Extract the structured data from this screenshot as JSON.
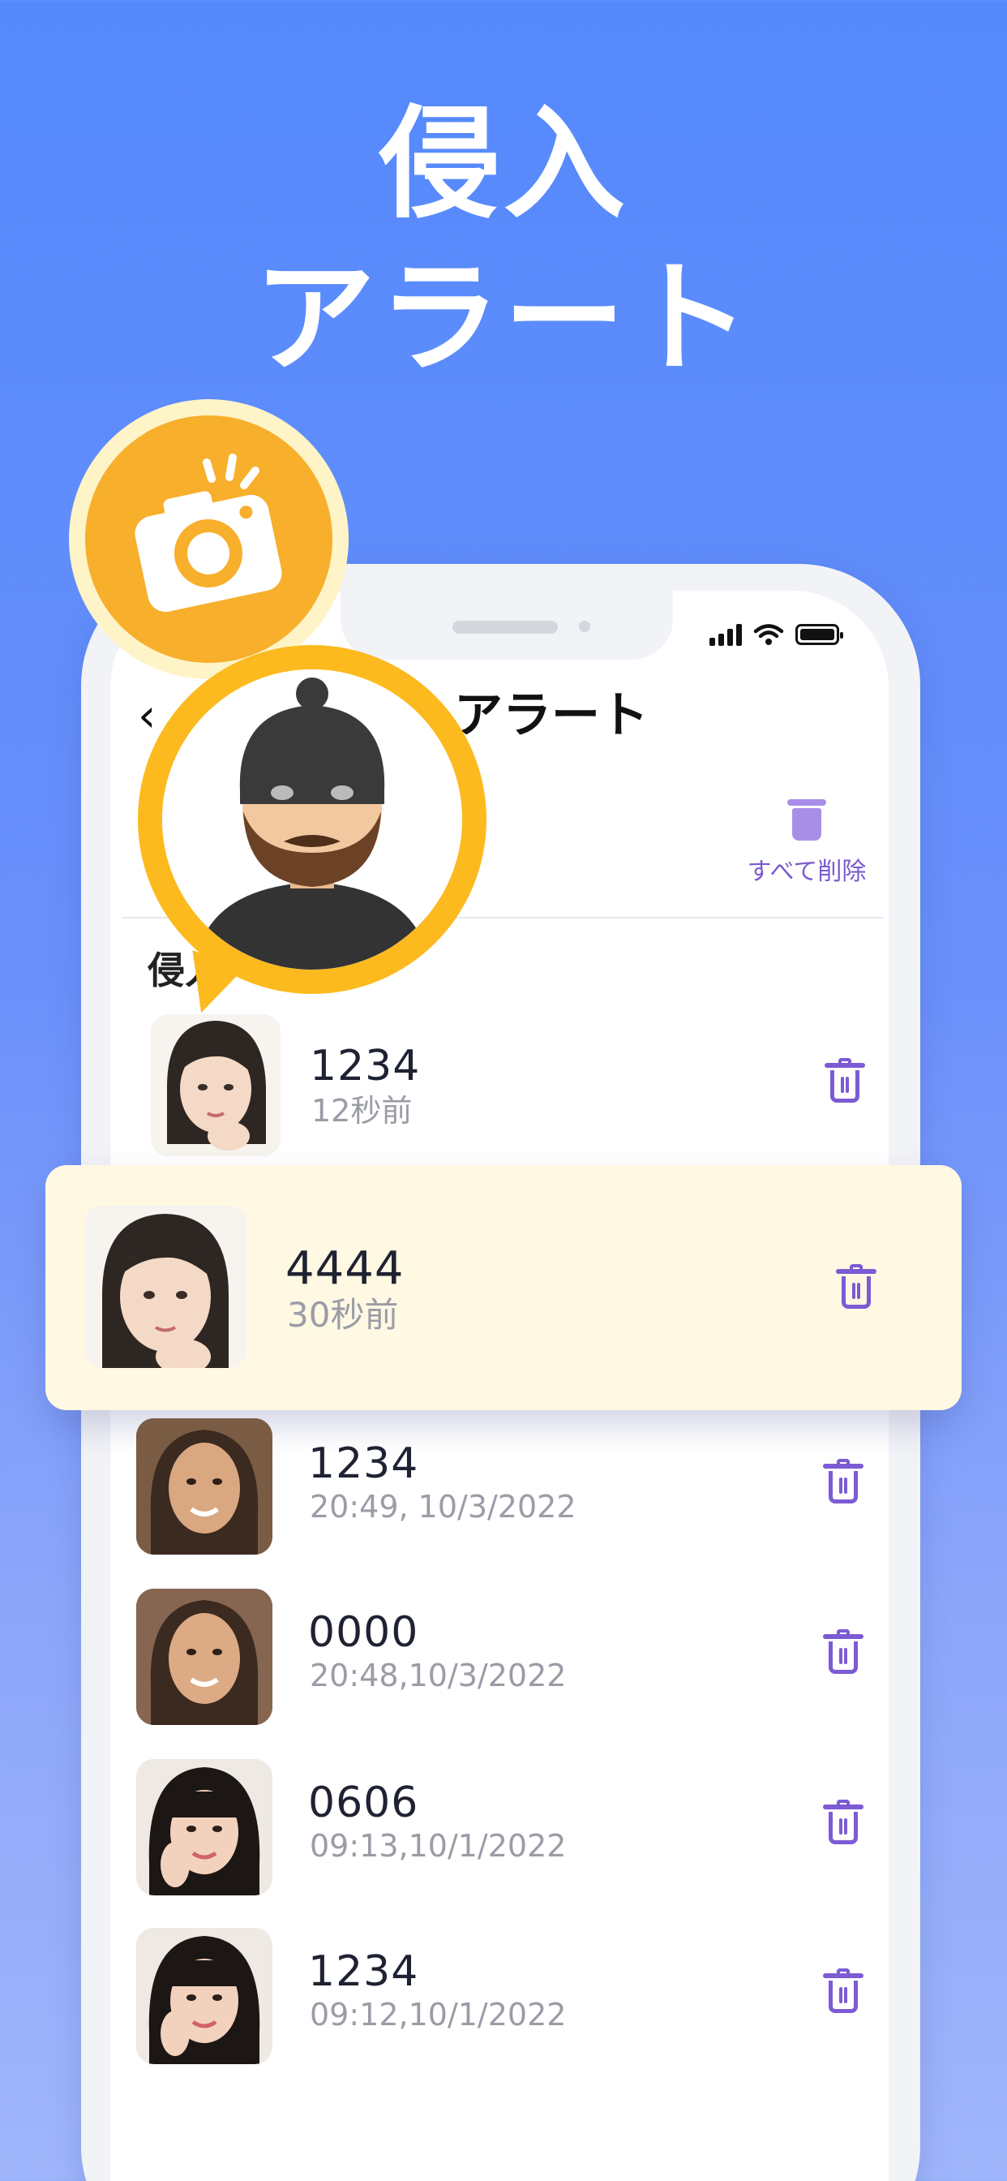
{
  "hero": {
    "line1": "侵入",
    "line2": "アラート"
  },
  "status_bar": {
    "icons": [
      "signal-icon",
      "wifi-icon",
      "battery-icon"
    ]
  },
  "nav": {
    "back_icon": "‹",
    "title": "アラート"
  },
  "delete_all": {
    "label": "すべて削除",
    "icon": "trash-icon"
  },
  "section": {
    "label": "侵入"
  },
  "rows": [
    {
      "code": "1234",
      "time": "12秒前"
    },
    {
      "code": "4444",
      "time": "30秒前"
    },
    {
      "code": "1234",
      "time": "20:49, 10/3/2022"
    },
    {
      "code": "0000",
      "time": "20:48,10/3/2022"
    },
    {
      "code": "0606",
      "time": "09:13,10/1/2022"
    },
    {
      "code": "1234",
      "time": "09:12,10/1/2022"
    }
  ],
  "colors": {
    "background_top": "#5489fc",
    "accent_purple": "#7c5bd4",
    "badge_orange": "#f7af2c",
    "badge_yellow": "#fcba1f",
    "highlight_bg": "#fff8e3"
  }
}
